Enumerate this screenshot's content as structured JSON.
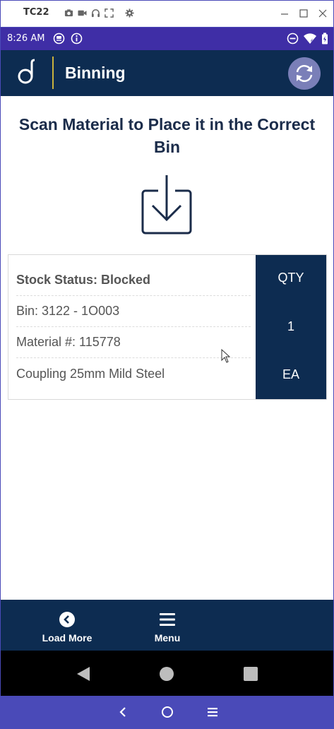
{
  "window": {
    "title": "TC22",
    "toolbar_icons": [
      "camera-icon",
      "video-icon",
      "headset-icon",
      "fullscreen-icon",
      "settings-icon"
    ],
    "controls": [
      "minimize-icon",
      "maximize-icon",
      "close-icon"
    ]
  },
  "statusbar": {
    "time": "8:26 AM",
    "icons": [
      "app-notification-icon",
      "info-icon",
      "do-not-disturb-icon",
      "wifi-icon",
      "battery-icon"
    ]
  },
  "appbar": {
    "title": "Binning",
    "logo": "d-logo",
    "refresh_icon": "refresh-icon"
  },
  "instruction": "Scan Material to Place it in the Correct Bin",
  "card": {
    "stock_status": "Stock Status: Blocked",
    "bin": "Bin: 3122 - 1O003",
    "material": "Material #: 115778",
    "description": "Coupling 25mm Mild Steel",
    "qty_label": "QTY",
    "qty_value": "1",
    "qty_unit": "EA"
  },
  "bottom_nav": {
    "load_more": "Load More",
    "menu": "Menu"
  },
  "colors": {
    "navy": "#0d2c51",
    "statusbar": "#3f2ea6",
    "host_frame": "#4a4ab8",
    "accent_gold": "#c9b23c",
    "refresh_circle": "#7a7fb8"
  }
}
